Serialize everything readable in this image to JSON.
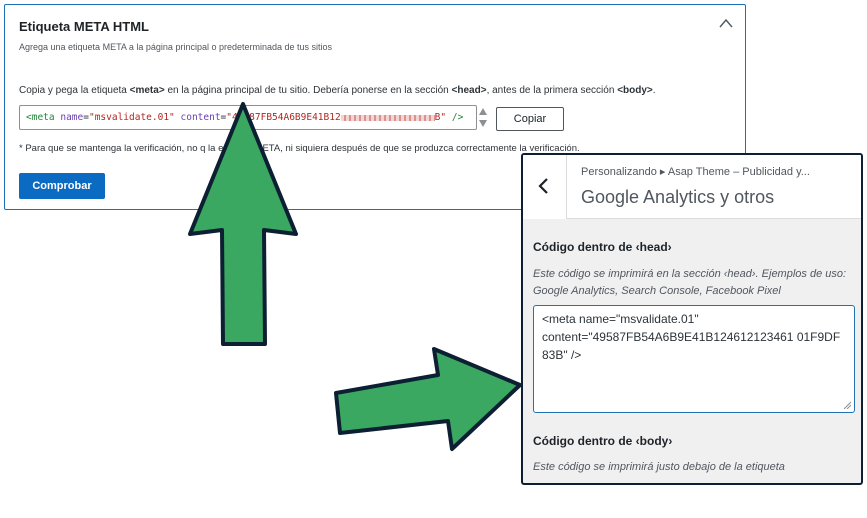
{
  "bing": {
    "title": "Etiqueta META HTML",
    "subtitle": "Agrega una etiqueta META a la página principal o predeterminada de tus sitios",
    "instructions_pre": "Copia y pega la etiqueta ",
    "instructions_tag1": "<meta>",
    "instructions_mid": " en la página principal de tu sitio. Debería ponerse en la sección ",
    "instructions_tag2": "<head>",
    "instructions_mid2": ", antes de la primera sección ",
    "instructions_tag3": "<body>",
    "instructions_end": ".",
    "code": {
      "open": "<meta",
      "attr1": "name",
      "val1": "\"msvalidate.01\"",
      "attr2": "content",
      "val2_start": "\"49587FB54A6B9E41B12",
      "val2_end": "B\"",
      "close": "/>"
    },
    "copy_label": "Copiar",
    "note": "* Para que se mantenga la verificación, no q    la etiqueta META, ni siquiera después de que se produzca correctamente la verificación.",
    "check_label": "Comprobar"
  },
  "wp": {
    "breadcrumb": "Personalizando ▸ Asap Theme – Publicidad y...",
    "title": "Google Analytics y otros",
    "head_label": "Código dentro de ‹head›",
    "head_desc": "Este código se imprimirá en la sección ‹head›. Ejemplos de uso: Google Analytics, Search Console, Facebook Pixel",
    "head_value": "<meta name=\"msvalidate.01\"\ncontent=\"49587FB54A6B9E41B124612123461 01F9DF83B\" />",
    "body_label": "Código dentro de ‹body›",
    "body_desc": "Este código se imprimirá justo debajo de la etiqueta"
  },
  "colors": {
    "arrow_fill": "#3aa860",
    "arrow_stroke": "#0c1f33",
    "primary_button": "#0b6ac2",
    "panel_border": "#1d6fb8"
  }
}
